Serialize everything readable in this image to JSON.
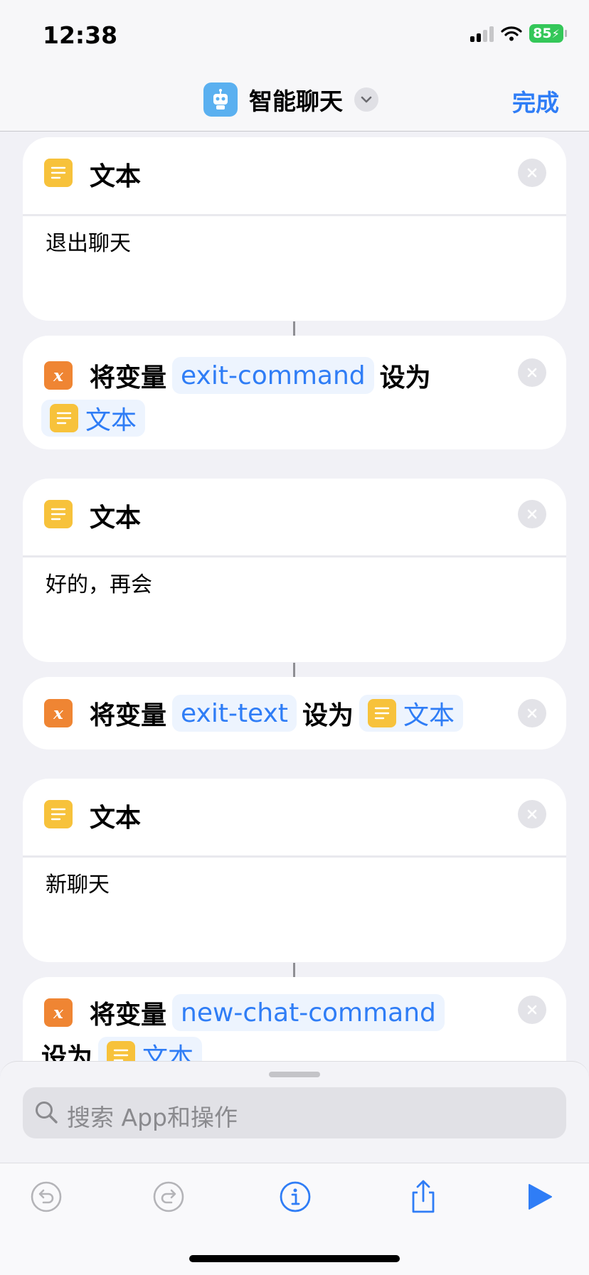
{
  "status": {
    "time": "12:38",
    "battery": "85"
  },
  "nav": {
    "title": "智能聊天",
    "done_label": "完成"
  },
  "blocks": [
    {
      "type": "text",
      "title": "文本",
      "body": "退出聊天"
    },
    {
      "type": "set_variable",
      "prefix": "将变量",
      "variable": "exit-command",
      "middle": "设为",
      "value": "文本"
    },
    {
      "type": "text",
      "title": "文本",
      "body": "好的，再会"
    },
    {
      "type": "set_variable",
      "prefix": "将变量",
      "variable": "exit-text",
      "middle": "设为",
      "value": "文本"
    },
    {
      "type": "text",
      "title": "文本",
      "body": "新聊天"
    },
    {
      "type": "set_variable",
      "prefix": "将变量",
      "variable": "new-chat-command",
      "middle": "设为",
      "value": "文本"
    }
  ],
  "search": {
    "placeholder": "搜索 App和操作"
  },
  "toolbar": {
    "icons": [
      "undo-icon",
      "redo-icon",
      "info-icon",
      "share-icon",
      "play-icon"
    ]
  },
  "colors": {
    "accent": "#2f7df6",
    "text_action": "#f7c23b",
    "variable_action": "#ef8533"
  }
}
